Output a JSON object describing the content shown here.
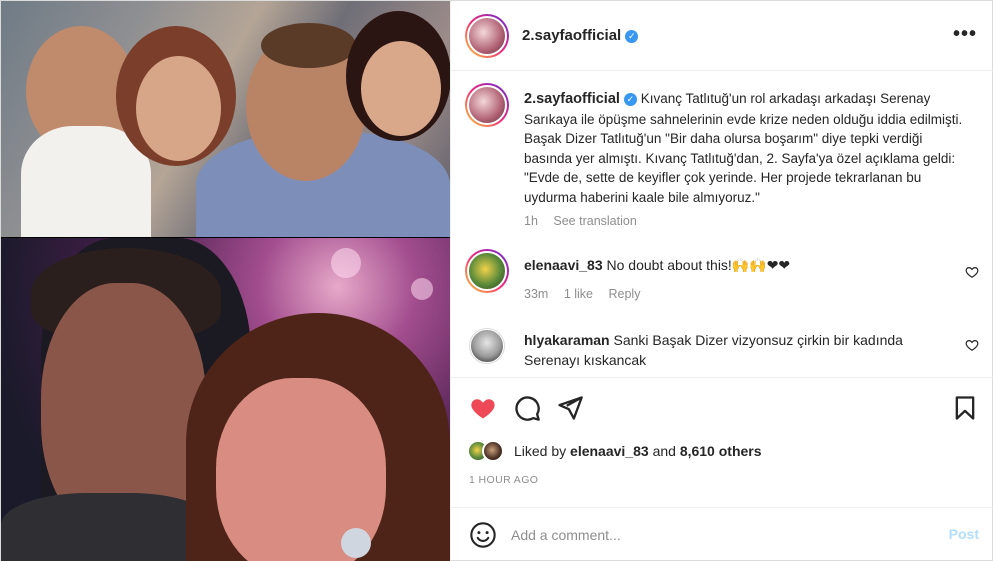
{
  "post": {
    "username": "2.sayfaofficial",
    "verified": true,
    "more_icon": "ellipsis-icon"
  },
  "caption": {
    "username": "2.sayfaofficial",
    "text": "Kıvanç Tatlıtuğ'un rol arkadaşı arkadaşı Serenay Sarıkaya ile öpüşme sahnelerinin evde krize neden olduğu iddia edilmişti. Başak Dizer Tatlıtuğ'un \"Bir daha olursa boşarım\" diye tepki verdiği basında yer almıştı. Kıvanç Tatlıtuğ'dan, 2. Sayfa'ya özel açıklama geldi: \"Evde de, sette de keyifler çok yerinde. Her projede tekrarlanan bu uydurma haberini kaale bile almıyoruz.\"",
    "time": "1h",
    "see_translation": "See translation"
  },
  "comments": [
    {
      "username": "elenaavi_83",
      "text": "No doubt about this!🙌🙌❤❤",
      "time": "33m",
      "likes": "1 like",
      "reply": "Reply"
    },
    {
      "username": "hlyakaraman",
      "text": "Sanki Başak Dizer vizyonsuz çirkin bir kadında Serenayı kıskancak"
    }
  ],
  "actions": {
    "like_icon": "heart-filled-icon",
    "comment_icon": "comment-icon",
    "share_icon": "send-icon",
    "save_icon": "bookmark-icon"
  },
  "likes": {
    "prefix": "Liked by",
    "user": "elenaavi_83",
    "and": "and",
    "count": "8,610 others"
  },
  "timestamp": "1 HOUR AGO",
  "add_comment": {
    "placeholder": "Add a comment...",
    "post_label": "Post"
  },
  "colors": {
    "like_red": "#ed4956",
    "verified_blue": "#3897f0",
    "post_button": "#b2dffc"
  }
}
